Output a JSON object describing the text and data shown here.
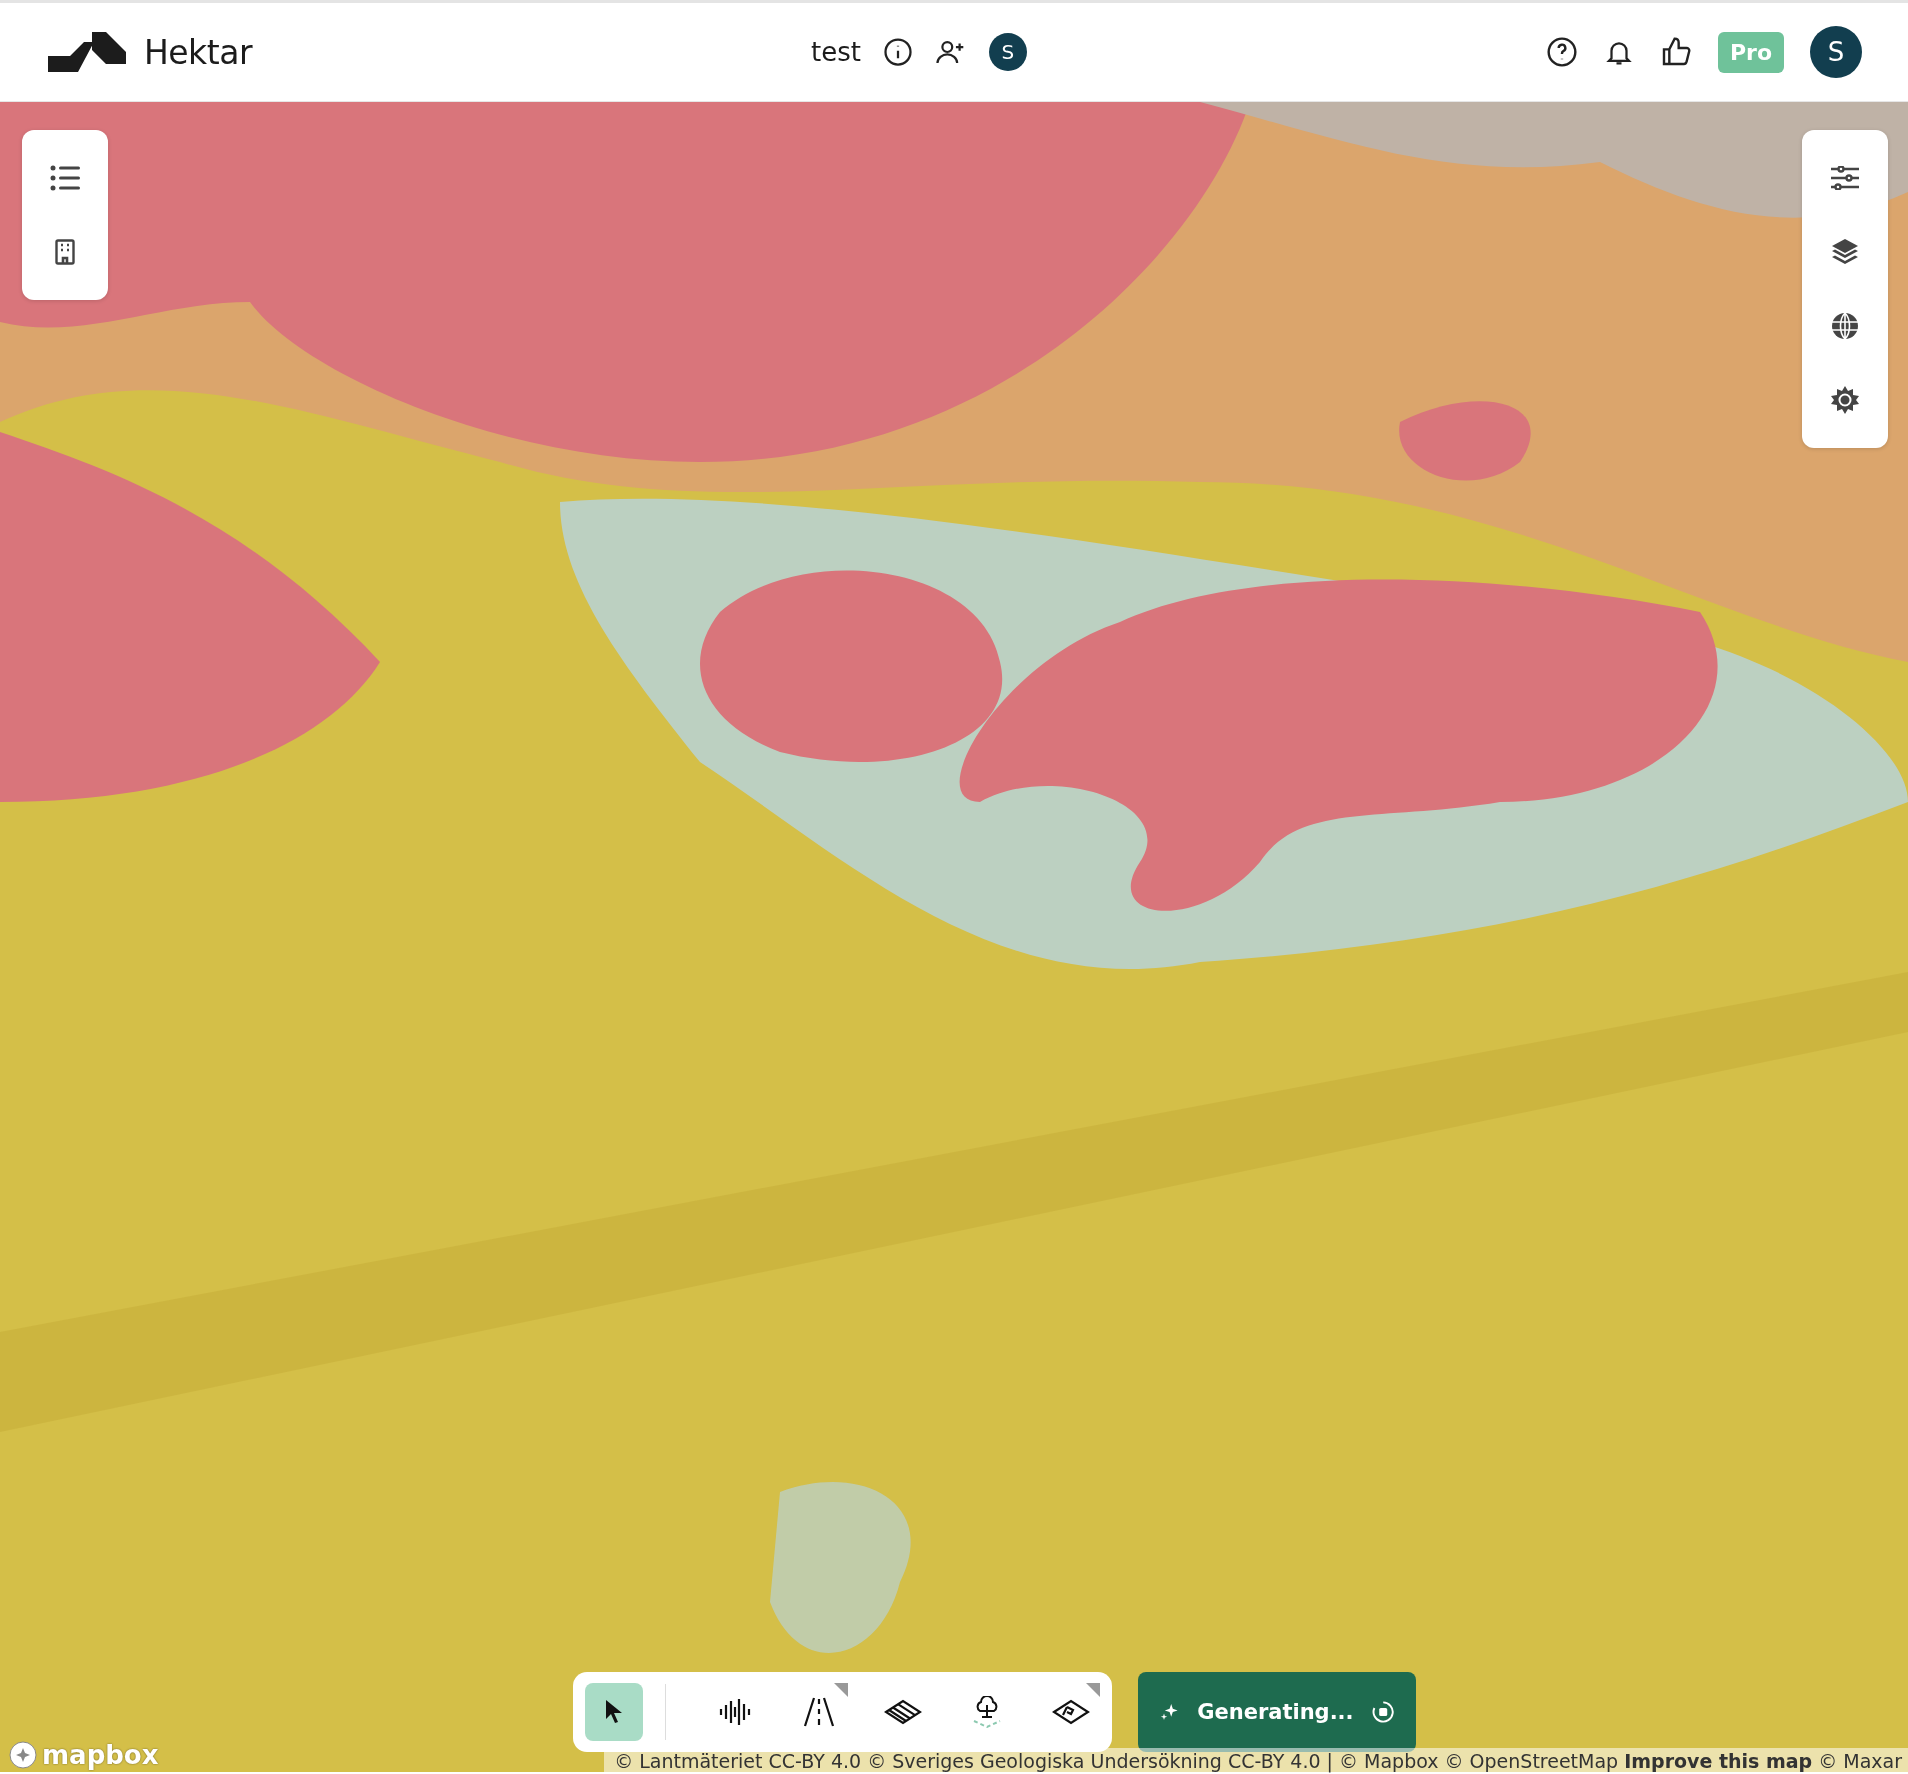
{
  "header": {
    "brand": "Hektar",
    "project": "test",
    "collaborator_initial": "S",
    "plan_badge": "Pro",
    "user_initial": "S"
  },
  "left_panel": {
    "buttons": [
      {
        "selected": false
      },
      {
        "selected": false
      }
    ]
  },
  "right_panel": {
    "buttons": [
      {
        "selected": false
      },
      {
        "selected": false
      },
      {
        "selected": false
      },
      {
        "selected": false
      }
    ]
  },
  "toolbar": {
    "tools": [
      {
        "selected": true,
        "submenu": false
      },
      {
        "selected": false,
        "submenu": false
      },
      {
        "selected": false,
        "submenu": true
      },
      {
        "selected": false,
        "submenu": false
      },
      {
        "selected": false,
        "submenu": false
      },
      {
        "selected": false,
        "submenu": true
      }
    ]
  },
  "generate_button": {
    "label": "Generating..."
  },
  "map": {
    "logo": "mapbox",
    "attribution": "© Lantmäteriet CC-BY 4.0 © Sveriges Geologiska Undersökning CC-BY 4.0 | © Mapbox © OpenStreetMap",
    "improve_link": "Improve this map",
    "attribution_end": "© Maxar"
  }
}
